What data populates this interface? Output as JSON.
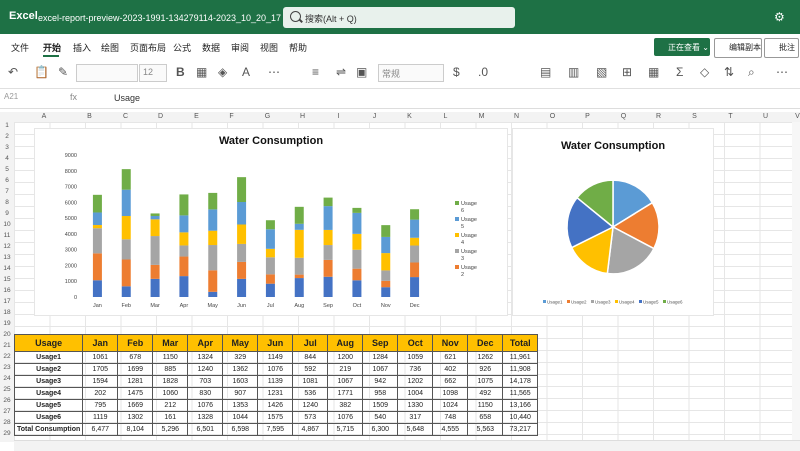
{
  "title_bar": {
    "app": "Excel",
    "document": "excel-report-preview-2023-1991-134279114-2023_10_20_17 - 仅供查看 ⌄",
    "search_placeholder": "搜索(Alt + Q)"
  },
  "menu": [
    "文件",
    "开始",
    "插入",
    "绘图",
    "页面布局",
    "公式",
    "数据",
    "审阅",
    "视图",
    "帮助"
  ],
  "menu_active": "开始",
  "buttons": {
    "editing": "正在查看 ⌄",
    "edit_copy": "编辑副本",
    "comments": "批注"
  },
  "ribbon": {
    "font_size": "12",
    "number_format": "常规"
  },
  "formula_bar": {
    "cell": "A21",
    "fx": "fx",
    "value": "Usage"
  },
  "columns": [
    "A",
    "B",
    "C",
    "D",
    "E",
    "F",
    "G",
    "H",
    "I",
    "J",
    "K",
    "L",
    "M",
    "N",
    "O",
    "P",
    "Q",
    "R",
    "S",
    "T",
    "U",
    "V",
    "W"
  ],
  "rows": [
    "1",
    "2",
    "3",
    "4",
    "5",
    "6",
    "7",
    "8",
    "9",
    "10",
    "11",
    "12",
    "13",
    "14",
    "15",
    "16",
    "17",
    "18",
    "19",
    "20",
    "21",
    "22",
    "23",
    "24",
    "25",
    "26",
    "27",
    "28",
    "29"
  ],
  "colors": {
    "brand": "#1e7145",
    "header_fill": "#ffc000",
    "series": [
      "#4472c4",
      "#ed7d31",
      "#a5a5a5",
      "#ffc000",
      "#5b9bd5",
      "#70ad47"
    ]
  },
  "table": {
    "header": [
      "Usage",
      "Jan",
      "Feb",
      "Mar",
      "Apr",
      "May",
      "Jun",
      "Jul",
      "Aug",
      "Sep",
      "Oct",
      "Nov",
      "Dec",
      "Total"
    ],
    "rows": [
      [
        "Usage1",
        "1061",
        "678",
        "1150",
        "1324",
        "329",
        "1149",
        "844",
        "1200",
        "1284",
        "1059",
        "621",
        "1262",
        "11,961"
      ],
      [
        "Usage2",
        "1705",
        "1699",
        "885",
        "1240",
        "1362",
        "1076",
        "592",
        "219",
        "1067",
        "736",
        "402",
        "926",
        "11,908"
      ],
      [
        "Usage3",
        "1594",
        "1281",
        "1828",
        "703",
        "1603",
        "1139",
        "1081",
        "1067",
        "942",
        "1202",
        "662",
        "1075",
        "14,178"
      ],
      [
        "Usage4",
        "202",
        "1475",
        "1060",
        "830",
        "907",
        "1231",
        "536",
        "1771",
        "958",
        "1004",
        "1098",
        "492",
        "11,565"
      ],
      [
        "Usage5",
        "795",
        "1669",
        "212",
        "1076",
        "1353",
        "1426",
        "1240",
        "382",
        "1509",
        "1330",
        "1024",
        "1150",
        "13,166"
      ],
      [
        "Usage6",
        "1119",
        "1302",
        "161",
        "1328",
        "1044",
        "1575",
        "573",
        "1076",
        "540",
        "317",
        "748",
        "658",
        "10,440"
      ],
      [
        "Total Consumption",
        "6,477",
        "8,104",
        "5,296",
        "6,501",
        "6,598",
        "7,595",
        "4,867",
        "5,715",
        "6,300",
        "5,648",
        "4,555",
        "5,563",
        "73,217"
      ]
    ]
  },
  "chart_data": [
    {
      "type": "bar",
      "stacked": true,
      "title": "Water Consumption",
      "categories": [
        "Jan",
        "Feb",
        "Mar",
        "Apr",
        "May",
        "Jun",
        "Jul",
        "Aug",
        "Sep",
        "Oct",
        "Nov",
        "Dec"
      ],
      "series": [
        {
          "name": "Usage1",
          "values": [
            1061,
            678,
            1150,
            1324,
            329,
            1149,
            844,
            1200,
            1284,
            1059,
            621,
            1262
          ]
        },
        {
          "name": "Usage2",
          "values": [
            1705,
            1699,
            885,
            1240,
            1362,
            1076,
            592,
            219,
            1067,
            736,
            402,
            926
          ]
        },
        {
          "name": "Usage3",
          "values": [
            1594,
            1281,
            1828,
            703,
            1603,
            1139,
            1081,
            1067,
            942,
            1202,
            662,
            1075
          ]
        },
        {
          "name": "Usage4",
          "values": [
            202,
            1475,
            1060,
            830,
            907,
            1231,
            536,
            1771,
            958,
            1004,
            1098,
            492
          ]
        },
        {
          "name": "Usage5",
          "values": [
            795,
            1669,
            212,
            1076,
            1353,
            1426,
            1240,
            382,
            1509,
            1330,
            1024,
            1150
          ]
        },
        {
          "name": "Usage6",
          "values": [
            1119,
            1302,
            161,
            1328,
            1044,
            1575,
            573,
            1076,
            540,
            317,
            748,
            658
          ]
        }
      ],
      "yticks": [
        0,
        1000,
        2000,
        3000,
        4000,
        5000,
        6000,
        7000,
        8000,
        9000
      ],
      "ylim": [
        0,
        9000
      ],
      "grid": false,
      "legend": "right",
      "legend_labels": [
        "Usage 6",
        "Usage 5",
        "Usage 4",
        "Usage 3",
        "Usage 2"
      ]
    },
    {
      "type": "pie",
      "title": "Water Consumption",
      "labels": [
        "Usage1",
        "Usage2",
        "Usage3",
        "Usage4",
        "Usage5",
        "Usage6"
      ],
      "values": [
        11961,
        11908,
        14178,
        11565,
        13166,
        10440
      ],
      "legend": "bottom"
    }
  ]
}
